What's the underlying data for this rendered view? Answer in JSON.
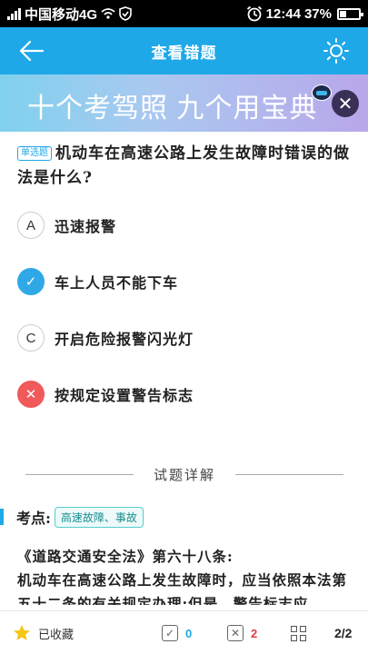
{
  "status_bar": {
    "carrier": "中国移动4G",
    "hd_label": "HD",
    "time": "12:44",
    "battery_percent": "37%",
    "battery_level": 0.37
  },
  "nav": {
    "title": "查看错题",
    "back_icon": "arrow-left-icon",
    "theme_icon": "sun-icon"
  },
  "banner": {
    "text": "十个考驾照 九个用宝典",
    "close_icon": "close-icon"
  },
  "question": {
    "type_tag": "单选题",
    "text": "机动车在高速公路上发生故障时错误的做法是什么?",
    "options": [
      {
        "key": "A",
        "text": "迅速报警",
        "state": "normal"
      },
      {
        "key": "✓",
        "text": "车上人员不能下车",
        "state": "correct"
      },
      {
        "key": "C",
        "text": "开启危险报警闪光灯",
        "state": "normal"
      },
      {
        "key": "✕",
        "text": "按规定设置警告标志",
        "state": "wrong"
      }
    ]
  },
  "detail": {
    "heading": "试题详解",
    "kaodian_label": "考点:",
    "kaodian_tag": "高速故障、事故",
    "explanation_line1": "《道路交通安全法》第六十八条:",
    "explanation_line2": "机动车在高速公路上发生故障时，应当依照本法第五十二条的有关规定办理;但是，警告标志应"
  },
  "bottom_bar": {
    "favorite_label": "已收藏",
    "right_count": "0",
    "wrong_count": "2",
    "page": "2/2",
    "accent_color": "#1fa8e8",
    "wrong_color": "#e04040"
  }
}
